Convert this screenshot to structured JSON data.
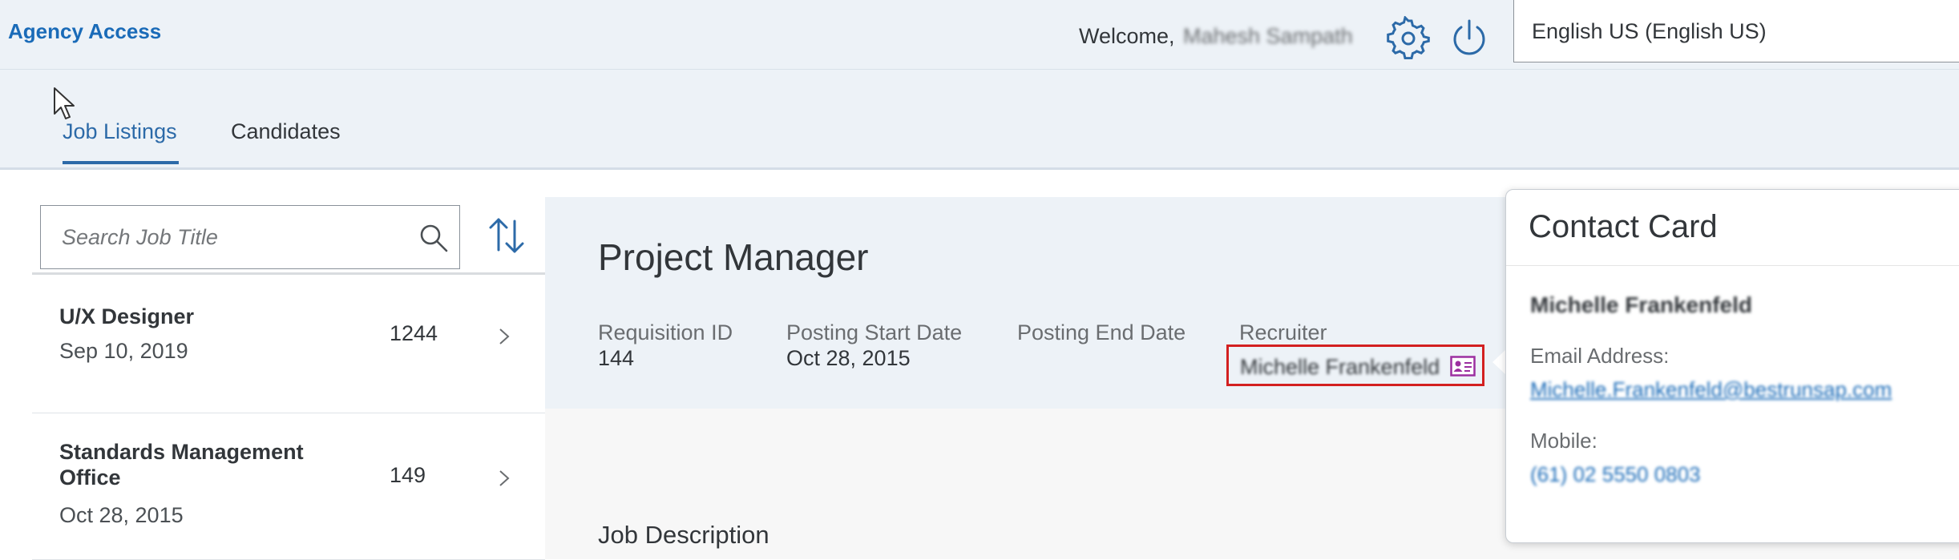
{
  "header": {
    "app_title": "Agency Access",
    "welcome_label": "Welcome,",
    "user_name": "Mahesh Sampath",
    "language": "English US (English US)"
  },
  "tabs": [
    {
      "label": "Job Listings",
      "active": true
    },
    {
      "label": "Candidates",
      "active": false
    }
  ],
  "search": {
    "placeholder": "Search Job Title"
  },
  "job_list": [
    {
      "title": "U/X Designer",
      "date": "Sep 10, 2019",
      "count": "1244"
    },
    {
      "title": "Standards Management Office",
      "date": "Oct 28, 2015",
      "count": "149"
    }
  ],
  "detail": {
    "title": "Project Manager",
    "requisition_id_label": "Requisition ID",
    "requisition_id": "144",
    "posting_start_label": "Posting Start Date",
    "posting_start": "Oct 28, 2015",
    "posting_end_label": "Posting End Date",
    "recruiter_label": "Recruiter",
    "recruiter_name": "Michelle Frankenfeld",
    "job_description_label": "Job Description"
  },
  "contact_card": {
    "title": "Contact Card",
    "name": "Michelle Frankenfeld",
    "email_label": "Email Address:",
    "email": "Michelle.Frankenfeld@bestrunsap.com",
    "mobile_label": "Mobile:",
    "mobile": "(61) 02 5550 0803"
  },
  "colors": {
    "accent": "#2c6aa8",
    "shell_bg": "#edf2f7",
    "highlight_border": "#d32020",
    "link": "#1a6bb8"
  }
}
